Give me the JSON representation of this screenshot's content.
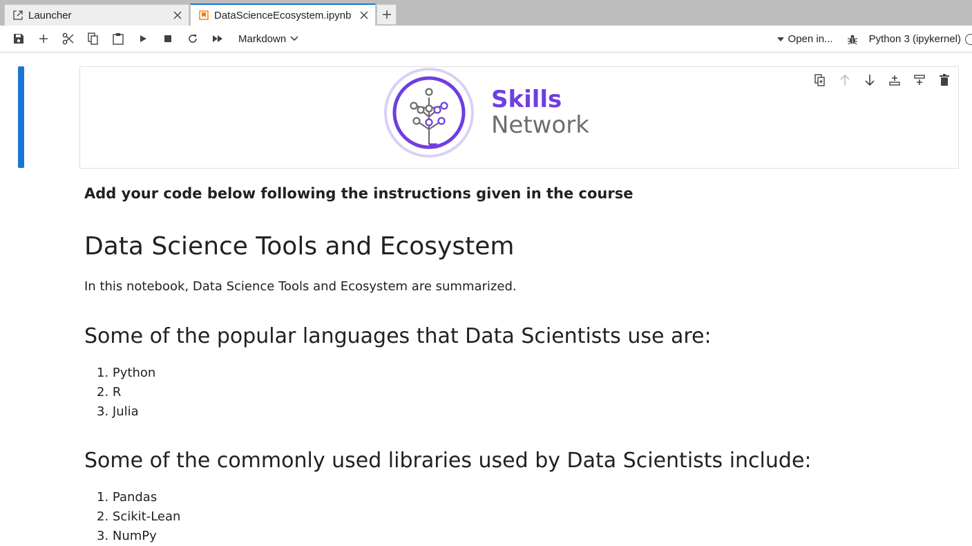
{
  "tabs": [
    {
      "label": "Launcher",
      "icon": "launcher-icon",
      "active": false
    },
    {
      "label": "DataScienceEcosystem.ipynb",
      "icon": "notebook-icon",
      "active": true
    }
  ],
  "toolbar": {
    "cell_type": "Markdown",
    "open_in": "Open in...",
    "kernel": "Python 3 (ipykernel)"
  },
  "logo": {
    "line1": "Skills",
    "line2": "Network"
  },
  "content": {
    "instructions": "Add your code below following the instructions given in the course",
    "title": "Data Science Tools and Ecosystem",
    "intro": "In this notebook, Data Science Tools and Ecosystem are summarized.",
    "languages_heading": "Some of the popular languages that Data Scientists use are:",
    "languages": [
      "1. Python",
      "2. R",
      "3. Julia"
    ],
    "libraries_heading": "Some of the commonly used libraries used by Data Scientists include:",
    "libraries": [
      "1. Pandas",
      "2. Scikit-Lean",
      "3. NumPy"
    ]
  },
  "colors": {
    "accent": "#1976d2",
    "notebook_icon": "#f57c00",
    "logo_purple": "#6f3ee0",
    "logo_gray": "#6d6d6d"
  }
}
